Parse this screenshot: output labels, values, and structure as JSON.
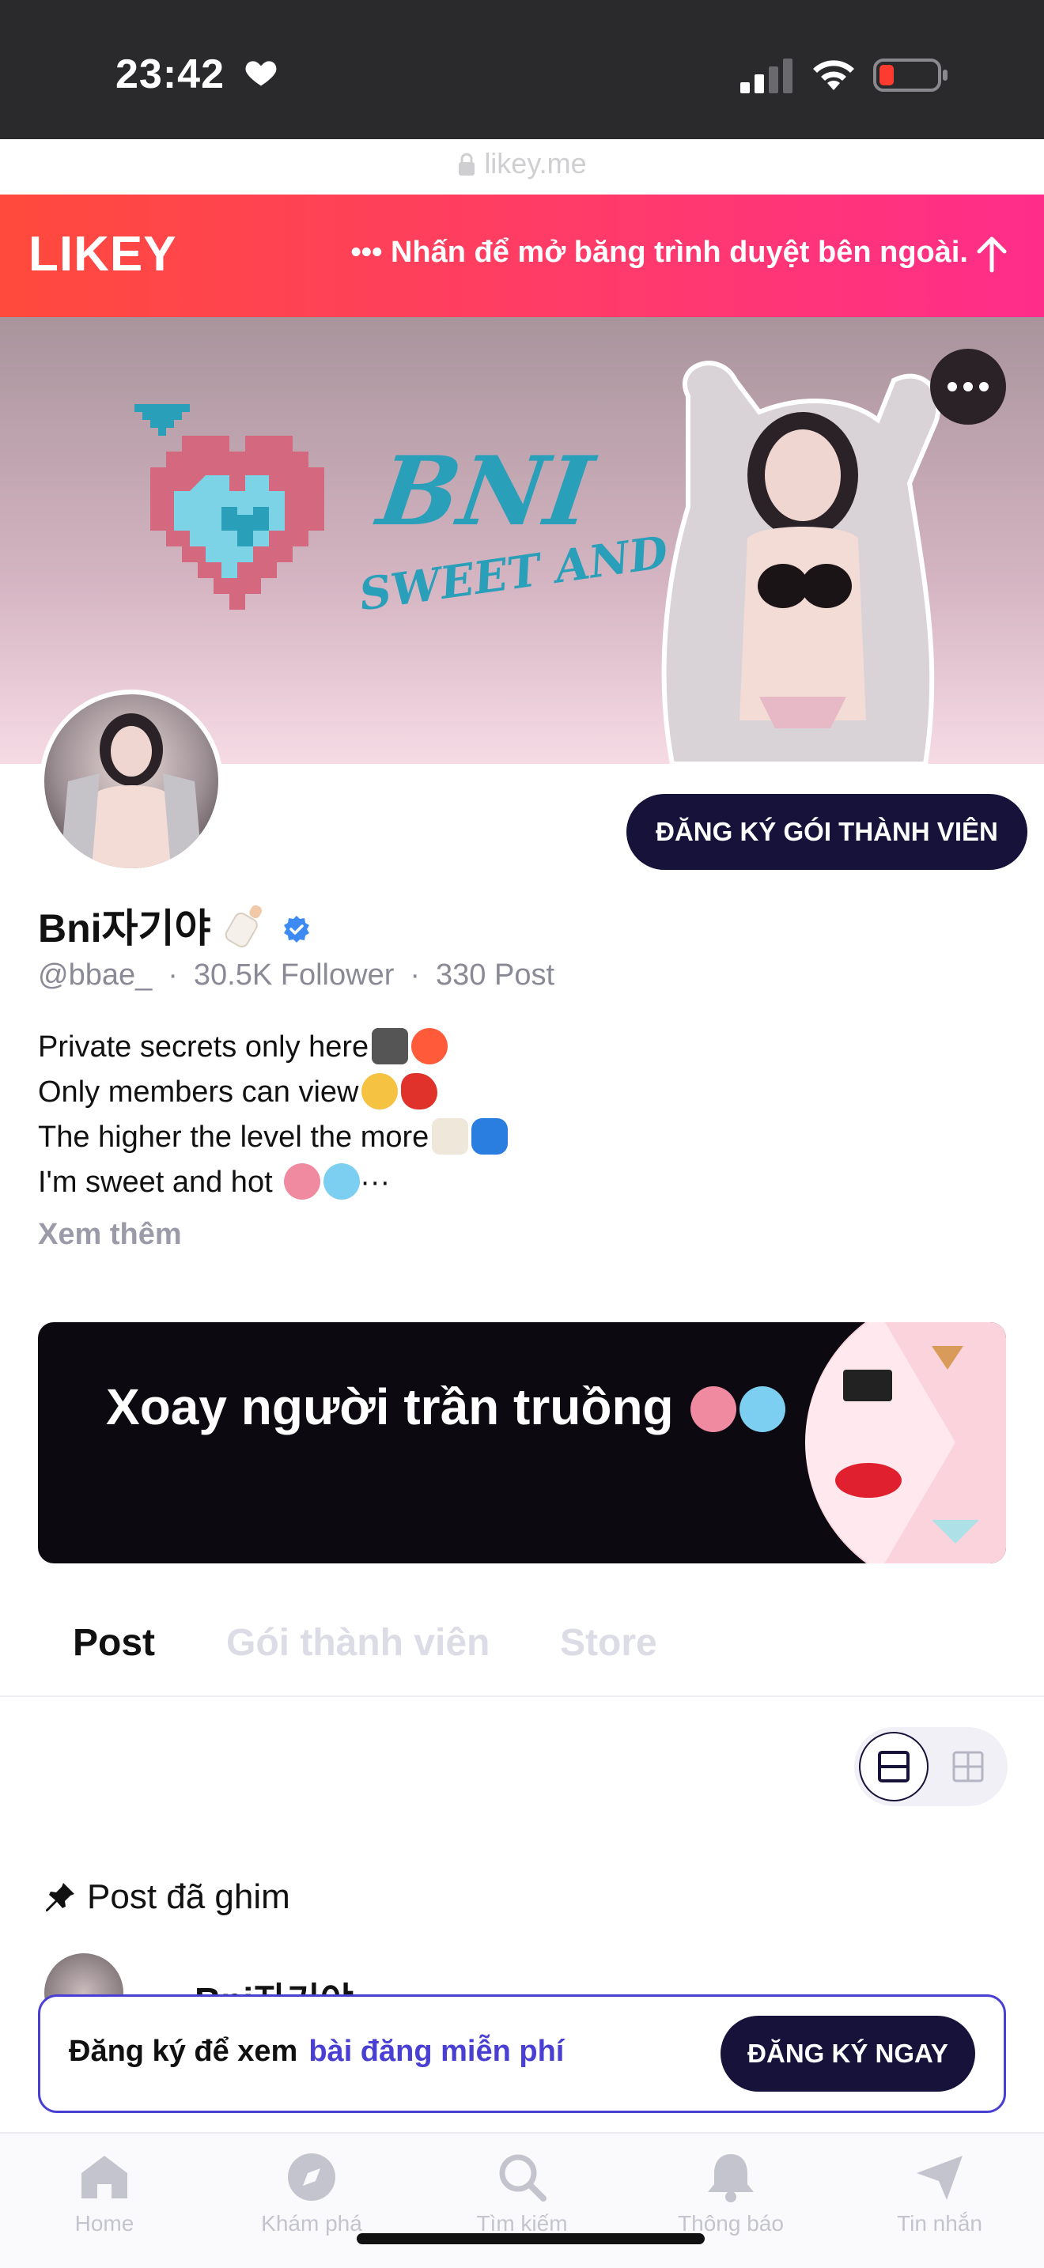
{
  "status_bar": {
    "time": "23:42",
    "url": "likey.me",
    "icons": [
      "heart-icon",
      "signal-icon",
      "wifi-icon",
      "battery-low-icon",
      "lock-icon"
    ]
  },
  "likey_banner": {
    "logo": "LIKEY",
    "open_text": "••• Nhấn để mở băng trình duyệt bên ngoài.",
    "arrow_icon": "arrow-up-icon"
  },
  "cover": {
    "title": "BNI",
    "subtitle": "SWEET AND HOT",
    "more_icon": "more-horizontal-icon"
  },
  "profile": {
    "subscribe_label": "ĐĂNG KÝ GÓI THÀNH VIÊN",
    "name": "Bni자기야",
    "handle": "@bbae_",
    "followers": "30.5K Follower",
    "posts": "330 Post",
    "bio": [
      "Private secrets only here",
      "Only members can view",
      "The higher the level the more",
      "I'm sweet and hot "
    ],
    "bio_ellipsis": "···",
    "see_more": "Xem thêm",
    "colors": {
      "verified": "#3d8bf2",
      "primary_button": "#16123a",
      "link": "#4a3fd3"
    }
  },
  "promo": {
    "text": "Xoay người trần truồng"
  },
  "tabs": [
    {
      "label": "Post",
      "active": true
    },
    {
      "label": "Gói thành viên",
      "active": false
    },
    {
      "label": "Store",
      "active": false
    }
  ],
  "view_toggle": {
    "icons": [
      "list-view-icon",
      "grid-view-icon"
    ],
    "selected": "list"
  },
  "pinned": {
    "label": "Post đã ghim",
    "icon": "pin-icon",
    "peek_name": "Bni자기야"
  },
  "signup_bar": {
    "text": "Đăng ký để xem",
    "link": "bài đăng miễn phí",
    "button": "ĐĂNG KÝ NGAY"
  },
  "bottom_nav": [
    {
      "label": "Home",
      "icon": "home-icon"
    },
    {
      "label": "Khám phá",
      "icon": "compass-icon"
    },
    {
      "label": "Tìm kiếm",
      "icon": "search-icon"
    },
    {
      "label": "Thông báo",
      "icon": "bell-icon"
    },
    {
      "label": "Tin nhắn",
      "icon": "send-icon"
    }
  ]
}
